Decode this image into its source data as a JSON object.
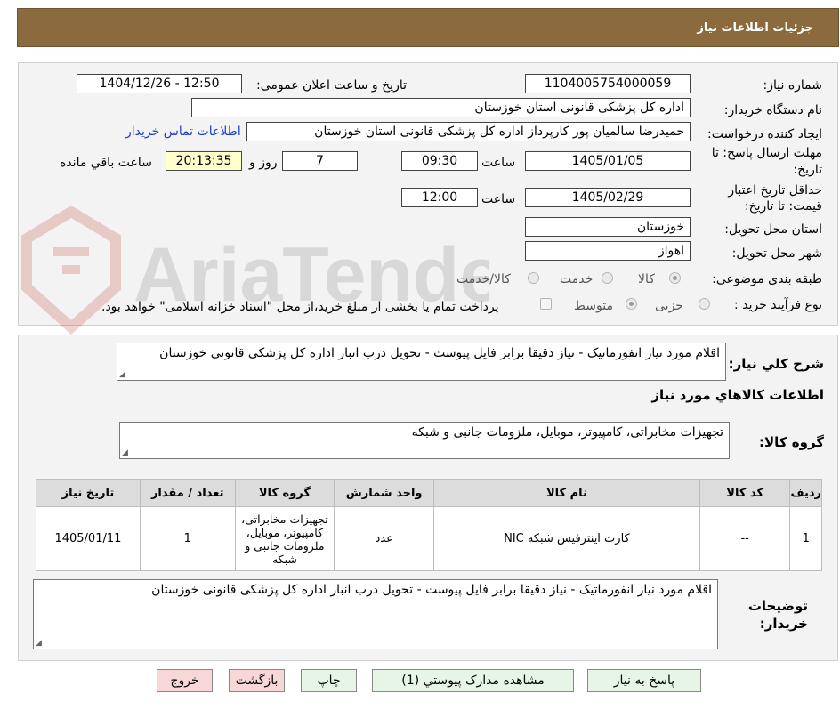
{
  "header": {
    "title": "جزئيات اطلاعات نياز"
  },
  "watermark": {
    "text": "AriaTender.neT"
  },
  "form": {
    "need_number_label": "شماره نیاز:",
    "need_number": "1104005754000059",
    "announce_label": "تاریخ و ساعت اعلان عمومی:",
    "announce_value": "1404/12/26 - 12:50",
    "buyer_org_label": "نام دستگاه خریدار:",
    "buyer_org": "اداره کل پزشکی قانونی استان خوزستان",
    "creator_label": "ایجاد کننده درخواست:",
    "creator": "حمیدرضا سالمیان پور کارپرداز اداره کل پزشکی قانونی استان خوزستان",
    "contact_link": "اطلاعات تماس خریدار",
    "deadline_label_1": "مهلت ارسال پاسخ: تا",
    "deadline_label_2": "تاریخ:",
    "deadline_date": "1405/01/05",
    "time_label": "ساعت",
    "deadline_time": "09:30",
    "days_value": "7",
    "days_label": "روز و",
    "remaining_time": "20:13:35",
    "remaining_label": "ساعت باقي مانده",
    "validity_label_1": "حداقل تاریخ اعتبار",
    "validity_label_2": "قیمت: تا تاریخ:",
    "validity_date": "1405/02/29",
    "validity_time": "12:00",
    "province_label": "استان محل تحویل:",
    "province": "خوزستان",
    "city_label": "شهر محل تحویل:",
    "city": "اهواز",
    "category_label": "طبقه بندی موضوعی:",
    "category_options": [
      "کالا",
      "خدمت",
      "کالا/خدمت"
    ],
    "process_label": "نوع فرآیند خرید :",
    "process_options": [
      "جزیی",
      "متوسط"
    ],
    "payment_note": "پرداخت تمام یا بخشی از مبلغ خرید،از محل \"اسناد خزانه اسلامی\" خواهد بود."
  },
  "details": {
    "description_label": "شرح کلي نياز:",
    "description": "اقلام مورد نیاز انفورماتیک - نیاز دقیقا برابر فایل پیوست - تحویل درب انبار اداره کل پزشکی قانونی خوزستان",
    "goods_info_title": "اطلاعات کالاهاي مورد نياز",
    "goods_group_label": "گروه کالا:",
    "goods_group": "تجهیزات مخابراتی، کامپیوتر، موبایل، ملزومات جانبی و شبکه",
    "table": {
      "headers": [
        "رديف",
        "کد کالا",
        "نام کالا",
        "واحد شمارش",
        "گروه کالا",
        "تعداد / مقدار",
        "تاریخ نیاز"
      ],
      "rows": [
        [
          "1",
          "--",
          "کارت اینترفیس شبکه NIC",
          "عدد",
          "تجهیزات مخابراتی، کامپیوتر، موبایل، ملزومات جانبی و شبکه",
          "1",
          "1405/01/11"
        ]
      ]
    },
    "buyer_notes_label_1": "توضیحات",
    "buyer_notes_label_2": "خریدار:",
    "buyer_notes": "اقلام مورد نیاز انفورماتیک - نیاز دقیقا برابر فایل پیوست - تحویل درب انبار اداره کل پزشکی قانونی خوزستان"
  },
  "buttons": {
    "reply": "پاسخ به نياز",
    "attachments": "مشاهده مدارک پيوستي (1)",
    "print": "چاپ",
    "back": "بازگشت",
    "exit": "خروج"
  },
  "colors": {
    "header_bg": "#8b6a3e",
    "remaining_bg": "#ffffcc",
    "link": "#1a3ed8",
    "green_button": "#e6f5e6",
    "red_button": "#f7d7d7"
  }
}
